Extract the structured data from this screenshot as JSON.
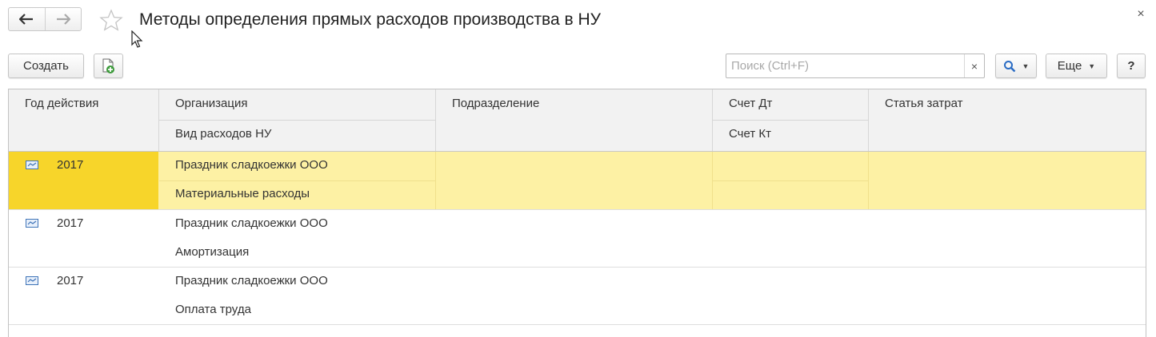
{
  "window": {
    "title": "Методы определения прямых расходов производства в НУ",
    "close_glyph": "×"
  },
  "icons": {
    "back": "arrow-left-icon",
    "forward": "arrow-right-icon",
    "favorite": "star-icon",
    "close": "close-icon",
    "copy": "copy-add-icon",
    "search": "magnifier-icon",
    "record": "register-record-icon"
  },
  "toolbar": {
    "create_label": "Создать",
    "search_placeholder": "Поиск (Ctrl+F)",
    "search_clear": "×",
    "more_label": "Еще",
    "help_label": "?"
  },
  "table": {
    "headers": {
      "year": "Год действия",
      "organization": "Организация",
      "expense_type": "Вид расходов НУ",
      "department": "Подразделение",
      "debit_account": "Счет Дт",
      "credit_account": "Счет Кт",
      "cost_item": "Статья затрат"
    },
    "rows": [
      {
        "year": "2017",
        "organization": "Праздник сладкоежки ООО",
        "expense_type": "Материальные расходы",
        "department": "",
        "debit_account": "",
        "credit_account": "",
        "cost_item": "",
        "selected": true
      },
      {
        "year": "2017",
        "organization": "Праздник сладкоежки ООО",
        "expense_type": "Амортизация",
        "department": "",
        "debit_account": "",
        "credit_account": "",
        "cost_item": "",
        "selected": false
      },
      {
        "year": "2017",
        "organization": "Праздник сладкоежки ООО",
        "expense_type": "Оплата труда",
        "department": "",
        "debit_account": "",
        "credit_account": "",
        "cost_item": "",
        "selected": false
      }
    ]
  },
  "colors": {
    "selected_row": "#fdf1a4",
    "selected_cell": "#f7d52a",
    "header_bg": "#f2f2f2",
    "accent_search": "#2a6cc4",
    "create_copy_green": "#3c9a3a"
  }
}
